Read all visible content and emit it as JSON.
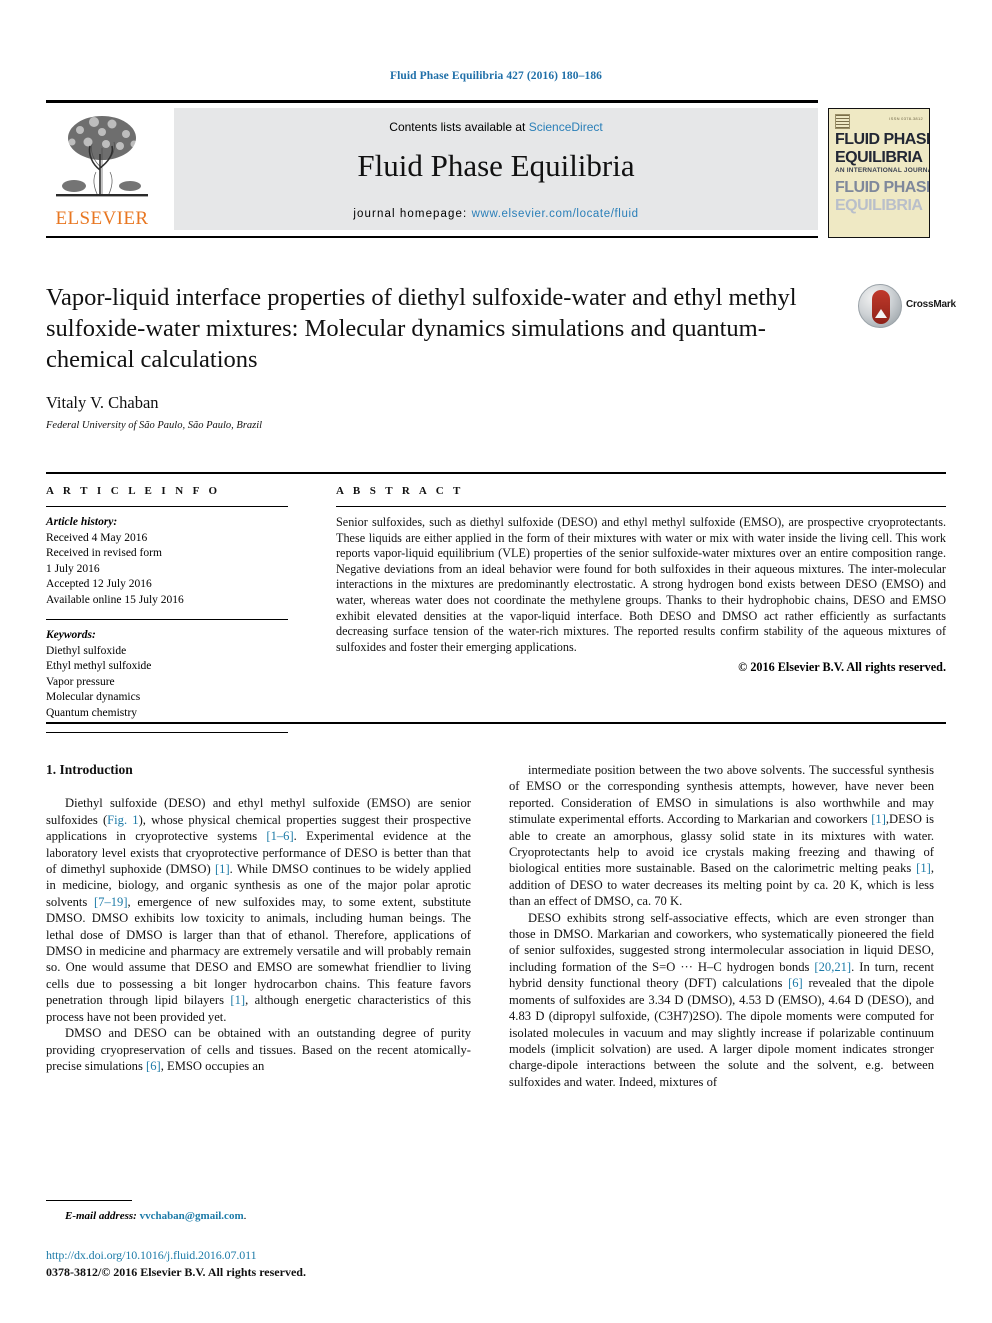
{
  "running_head": "Fluid Phase Equilibria 427 (2016) 180–186",
  "masthead": {
    "publisher_logo_label": "ELSEVIER",
    "contents_prefix": "Contents lists available at ",
    "contents_link": "ScienceDirect",
    "journal_name": "Fluid Phase Equilibria",
    "homepage_prefix": "journal homepage: ",
    "homepage_url": "www.elsevier.com/locate/fluid",
    "cover": {
      "issn_mark": "ISSN 0378-3812",
      "line1": "FLUID PHASE",
      "line2": "EQUILIBRIA",
      "line3": "AN INTERNATIONAL JOURNAL",
      "line4": "FLUID PHASE",
      "line5": "EQUILIBRIA"
    }
  },
  "title_block": {
    "title": "Vapor-liquid interface properties of diethyl sulfoxide-water and ethyl methyl sulfoxide-water mixtures: Molecular dynamics simulations and quantum-chemical calculations",
    "crossmark_label": "CrossMark",
    "author": "Vitaly V. Chaban",
    "affiliation": "Federal University of São Paulo, São Paulo, Brazil"
  },
  "article_info": {
    "heading": "A R T I C L E   I N F O",
    "history_label": "Article history:",
    "history_lines": [
      "Received 4 May 2016",
      "Received in revised form",
      "1 July 2016",
      "Accepted 12 July 2016",
      "Available online 15 July 2016"
    ],
    "keywords_label": "Keywords:",
    "keywords": [
      "Diethyl sulfoxide",
      "Ethyl methyl sulfoxide",
      "Vapor pressure",
      "Molecular dynamics",
      "Quantum chemistry"
    ]
  },
  "abstract": {
    "heading": "A B S T R A C T",
    "text": "Senior sulfoxides, such as diethyl sulfoxide (DESO) and ethyl methyl sulfoxide (EMSO), are prospective cryoprotectants. These liquids are either applied in the form of their mixtures with water or mix with water inside the living cell. This work reports vapor-liquid equilibrium (VLE) properties of the senior sulfoxide-water mixtures over an entire composition range. Negative deviations from an ideal behavior were found for both sulfoxides in their aqueous mixtures. The inter-molecular interactions in the mixtures are predominantly electrostatic. A strong hydrogen bond exists between DESO (EMSO) and water, whereas water does not coordinate the methylene groups. Thanks to their hydrophobic chains, DESO and EMSO exhibit elevated densities at the vapor-liquid interface. Both DESO and DMSO act rather efficiently as surfactants decreasing surface tension of the water-rich mixtures. The reported results confirm stability of the aqueous mixtures of sulfoxides and foster their emerging applications.",
    "copyright": "© 2016 Elsevier B.V. All rights reserved."
  },
  "body": {
    "section_title": "1. Introduction",
    "left_paragraphs": [
      "Diethyl sulfoxide (DESO) and ethyl methyl sulfoxide (EMSO) are senior sulfoxides (Fig. 1), whose physical chemical properties suggest their prospective applications in cryoprotective systems [1–6]. Experimental evidence at the laboratory level exists that cryoprotective performance of DESO is better than that of dimethyl suphoxide (DMSO) [1]. While DMSO continues to be widely applied in medicine, biology, and organic synthesis as one of the major polar aprotic solvents [7–19], emergence of new sulfoxides may, to some extent, substitute DMSO. DMSO exhibits low toxicity to animals, including human beings. The lethal dose of DMSO is larger than that of ethanol. Therefore, applications of DMSO in medicine and pharmacy are extremely versatile and will probably remain so. One would assume that DESO and EMSO are somewhat friendlier to living cells due to possessing a bit longer hydrocarbon chains. This feature favors penetration through lipid bilayers [1], although energetic characteristics of this process have not been provided yet.",
      "DMSO and DESO can be obtained with an outstanding degree of purity providing cryopreservation of cells and tissues. Based on the recent atomically-precise simulations [6], EMSO occupies an"
    ],
    "right_paragraphs": [
      "intermediate position between the two above solvents. The successful synthesis of EMSO or the corresponding synthesis attempts, however, have never been reported. Consideration of EMSO in simulations is also worthwhile and may stimulate experimental efforts. According to Markarian and coworkers [1],DESO is able to create an amorphous, glassy solid state in its mixtures with water. Cryoprotectants help to avoid ice crystals making freezing and thawing of biological entities more sustainable. Based on the calorimetric melting peaks [1], addition of DESO to water decreases its melting point by ca. 20 K, which is less than an effect of DMSO, ca. 70 K.",
      "DESO exhibits strong self-associative effects, which are even stronger than those in DMSO. Markarian and coworkers, who systematically pioneered the field of senior sulfoxides, suggested strong intermolecular association in liquid DESO, including formation of the S=O ··· H–C hydrogen bonds [20,21]. In turn, recent hybrid density functional theory (DFT) calculations [6] revealed that the dipole moments of sulfoxides are 3.34 D (DMSO), 4.53 D (EMSO), 4.64 D (DESO), and 4.83 D (dipropyl sulfoxide, (C3H7)2SO). The dipole moments were computed for isolated molecules in vacuum and may slightly increase if polarizable continuum models (implicit solvation) are used. A larger dipole moment indicates stronger charge-dipole interactions between the solute and the solvent, e.g. between sulfoxides and water. Indeed, mixtures of"
    ]
  },
  "footnote": {
    "label": "E-mail address:",
    "email": "vvchaban@gmail.com"
  },
  "bottom_meta": {
    "doi": "http://dx.doi.org/10.1016/j.fluid.2016.07.011",
    "issn": "0378-3812/© 2016 Elsevier B.V. All rights reserved."
  },
  "colors": {
    "link": "#1d7ba8",
    "elsevier_orange": "#e87722",
    "band_gray": "#e6e7e8"
  }
}
